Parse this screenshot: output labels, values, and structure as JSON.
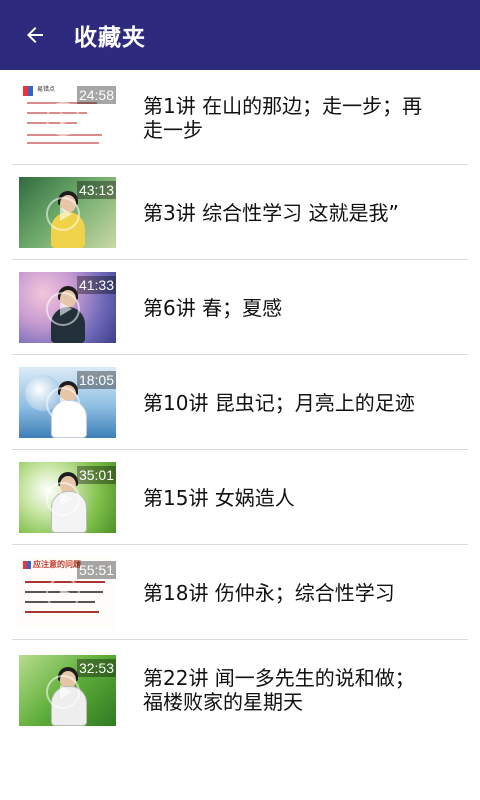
{
  "header": {
    "title": "收藏夹",
    "back_icon": "arrow-left-icon",
    "background": "#2e2a7e"
  },
  "items": [
    {
      "title": "第1讲 在山的那边；走一步；再走一步",
      "duration": "24:58",
      "thumb_caption": "易错点"
    },
    {
      "title": "第3讲 综合性学习 这就是我”",
      "duration": "43:13"
    },
    {
      "title": "第6讲 春；夏感",
      "duration": "41:33"
    },
    {
      "title": "第10讲 昆虫记；月亮上的足迹",
      "duration": "18:05"
    },
    {
      "title": "第15讲 女娲造人",
      "duration": "35:01"
    },
    {
      "title": "第18讲 伤仲永；综合性学习",
      "duration": "55:51",
      "thumb_caption": "应注意的问题"
    },
    {
      "title": "第22讲 闻一多先生的说和做；福楼败家的星期天",
      "duration": "32:53"
    }
  ]
}
